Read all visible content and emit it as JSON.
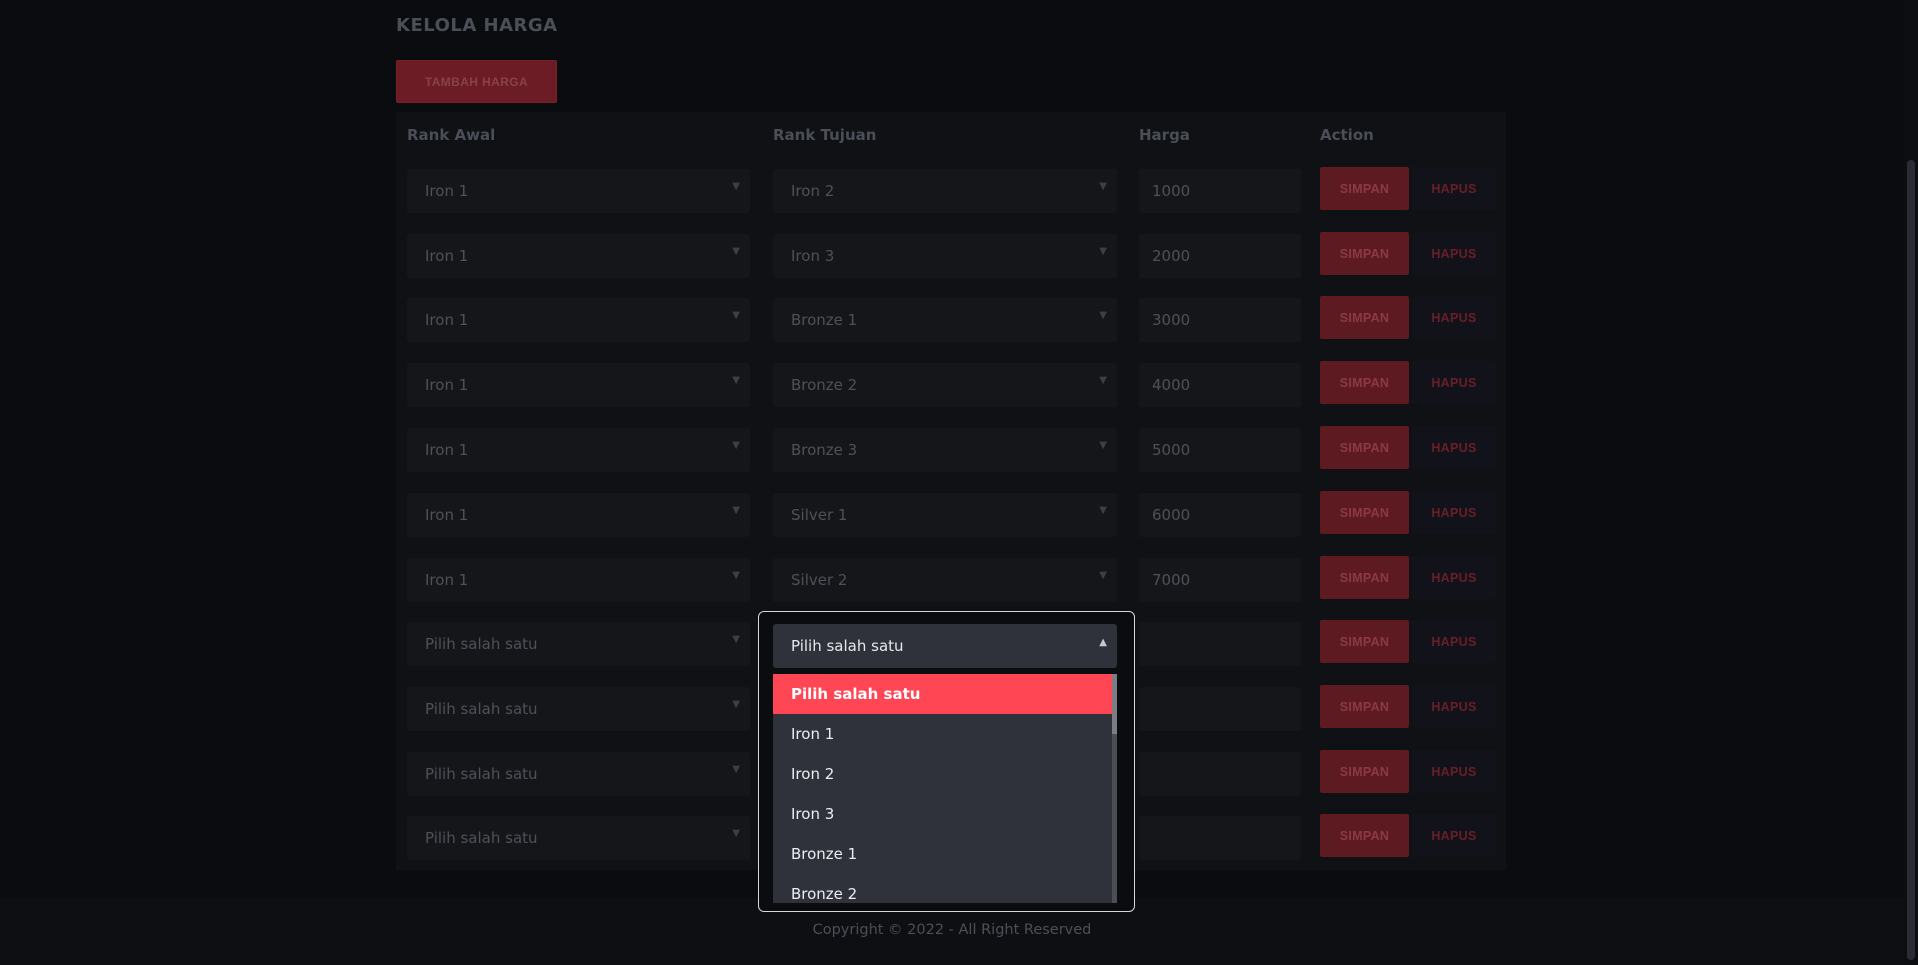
{
  "page": {
    "title": "KELOLA HARGA",
    "add_button": "TAMBAH HARGA"
  },
  "table": {
    "headers": {
      "rank_awal": "Rank Awal",
      "rank_tujuan": "Rank Tujuan",
      "harga": "Harga",
      "action": "Action"
    },
    "rows": [
      {
        "rank_awal": "Iron 1",
        "rank_tujuan": "Iron 2",
        "harga": "1000"
      },
      {
        "rank_awal": "Iron 1",
        "rank_tujuan": "Iron 3",
        "harga": "2000"
      },
      {
        "rank_awal": "Iron 1",
        "rank_tujuan": "Bronze 1",
        "harga": "3000"
      },
      {
        "rank_awal": "Iron 1",
        "rank_tujuan": "Bronze 2",
        "harga": "4000"
      },
      {
        "rank_awal": "Iron 1",
        "rank_tujuan": "Bronze 3",
        "harga": "5000"
      },
      {
        "rank_awal": "Iron 1",
        "rank_tujuan": "Silver 1",
        "harga": "6000"
      },
      {
        "rank_awal": "Iron 1",
        "rank_tujuan": "Silver 2",
        "harga": "7000"
      },
      {
        "rank_awal": "Pilih salah satu",
        "rank_tujuan": "Pilih salah satu",
        "harga": ""
      },
      {
        "rank_awal": "Pilih salah satu",
        "rank_tujuan": "",
        "harga": ""
      },
      {
        "rank_awal": "Pilih salah satu",
        "rank_tujuan": "",
        "harga": ""
      },
      {
        "rank_awal": "Pilih salah satu",
        "rank_tujuan": "",
        "harga": ""
      }
    ],
    "save_label": "SIMPAN",
    "delete_label": "HAPUS"
  },
  "dropdown": {
    "selected": "Pilih salah satu",
    "options": [
      "Pilih salah satu",
      "Iron 1",
      "Iron 2",
      "Iron 3",
      "Bronze 1",
      "Bronze 2"
    ],
    "highlight_color": "#ff4655"
  },
  "footer": {
    "text": "Copyright © 2022 - All Right Reserved"
  },
  "colors": {
    "accent": "#ff4655",
    "background": "#0b0c10"
  },
  "icons": {
    "select_chevron": "chevron-down-icon",
    "open_chevron": "chevron-up-icon"
  }
}
